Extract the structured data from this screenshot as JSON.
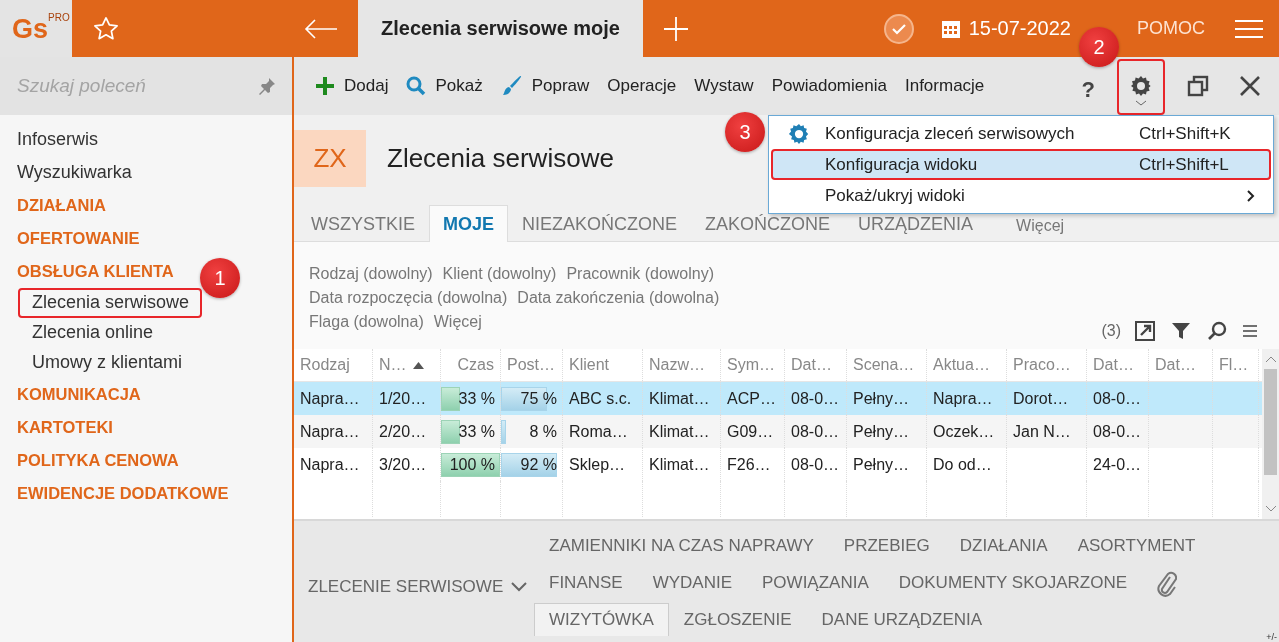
{
  "app": {
    "logo": "Gs",
    "logo_badge": "PRO"
  },
  "topbar": {
    "title": "Zlecenia serwisowe moje",
    "date": "15-07-2022",
    "help": "POMOC"
  },
  "sidebar": {
    "search": {
      "placeholder": "Szukaj poleceń"
    },
    "items": [
      {
        "label": "Infoserwis",
        "kind": "link"
      },
      {
        "label": "Wyszukiwarka",
        "kind": "link"
      },
      {
        "label": "DZIAŁANIA",
        "kind": "section"
      },
      {
        "label": "OFERTOWANIE",
        "kind": "section"
      },
      {
        "label": "OBSŁUGA KLIENTA",
        "kind": "section",
        "children": [
          {
            "label": "Zlecenia serwisowe",
            "highlighted": true,
            "annotation": "1"
          },
          {
            "label": "Zlecenia online",
            "highlighted": false
          },
          {
            "label": "Umowy z klientami",
            "highlighted": false
          }
        ]
      },
      {
        "label": "KOMUNIKACJA",
        "kind": "section"
      },
      {
        "label": "KARTOTEKI",
        "kind": "section"
      },
      {
        "label": "POLITYKA CENOWA",
        "kind": "section"
      },
      {
        "label": "EWIDENCJE DODATKOWE",
        "kind": "section"
      }
    ]
  },
  "toolbar": {
    "actions": [
      {
        "label": "Dodaj"
      },
      {
        "label": "Pokaż"
      },
      {
        "label": "Popraw"
      },
      {
        "label": "Operacje"
      },
      {
        "label": "Wystaw"
      },
      {
        "label": "Powiadomienia"
      },
      {
        "label": "Informacje"
      }
    ],
    "help": "?",
    "settings": {
      "highlighted": true,
      "annotation": "2"
    }
  },
  "menu": {
    "items": [
      {
        "label": "Konfiguracja zleceń serwisowych",
        "shortcut": "Ctrl+Shift+K",
        "selected": false,
        "highlighted": false,
        "annotation": "3"
      },
      {
        "label": "Konfiguracja widoku",
        "shortcut": "Ctrl+Shift+L",
        "selected": true,
        "highlighted": true
      },
      {
        "label": "Pokaż/ukryj widoki",
        "submenu": true,
        "selected": false,
        "highlighted": false
      }
    ]
  },
  "module": {
    "badge": "ZX",
    "title": "Zlecenia serwisowe"
  },
  "tabs": [
    {
      "label": "WSZYSTKIE",
      "selected": false
    },
    {
      "label": "MOJE",
      "selected": true
    },
    {
      "label": "NIEZAKOŃCZONE",
      "selected": false
    },
    {
      "label": "ZAKOŃCZONE",
      "selected": false
    },
    {
      "label": "URZĄDZENIA",
      "selected": false
    },
    {
      "label": "Więcej",
      "selected": false,
      "kind": "more"
    }
  ],
  "filters": [
    [
      "Rodzaj (dowolny)",
      "Klient (dowolny)",
      "Pracownik (dowolny)"
    ],
    [
      "Data rozpoczęcia (dowolna)",
      "Data zakończenia (dowolna)"
    ],
    [
      "Flaga (dowolna)",
      "Więcej"
    ]
  ],
  "count": "(3)",
  "table": {
    "columns": [
      {
        "label": "Rodzaj",
        "sorted": false
      },
      {
        "label": "N…",
        "sorted": true
      },
      {
        "label": "Czas",
        "sorted": false
      },
      {
        "label": "Post…",
        "sorted": false
      },
      {
        "label": "Klient",
        "sorted": false
      },
      {
        "label": "Nazw…",
        "sorted": false
      },
      {
        "label": "Sym…",
        "sorted": false
      },
      {
        "label": "Dat…",
        "sorted": false
      },
      {
        "label": "Scena…",
        "sorted": false
      },
      {
        "label": "Aktua…",
        "sorted": false
      },
      {
        "label": "Praco…",
        "sorted": false
      },
      {
        "label": "Dat…",
        "sorted": false
      },
      {
        "label": "Dat…",
        "sorted": false
      },
      {
        "label": "Fl…",
        "sorted": false
      }
    ],
    "rows": [
      {
        "selected": true,
        "cells": [
          "Napra…",
          "1/20…",
          {
            "text": "33 %",
            "level": 0.33
          },
          {
            "text": "75 %",
            "level": 0.75
          },
          "ABC s.c.",
          "Klimat…",
          "ACP…",
          "08-0…",
          "Pełny…",
          "Napra…",
          "Dorot…",
          "08-0…"
        ]
      },
      {
        "selected": false,
        "cells": [
          "Napra…",
          "2/20…",
          {
            "text": "33 %",
            "level": 0.33
          },
          {
            "text": "8 %",
            "level": 0.08
          },
          "Roma…",
          "Klimat…",
          "G09…",
          "08-0…",
          "Pełny…",
          "Oczek…",
          "Jan N…",
          "08-0…"
        ]
      },
      {
        "selected": false,
        "cells": [
          "Napra…",
          "3/20…",
          {
            "text": "100 %",
            "level": 1
          },
          {
            "text": "92 %",
            "level": 0.92
          },
          "Sklep…",
          "Klimat…",
          "F26…",
          "08-0…",
          "Pełny…",
          "Do od…",
          null,
          "24-0…"
        ]
      }
    ]
  },
  "details": {
    "section": "ZLECENIE SERWISOWE",
    "tab_rows": [
      [
        {
          "label": "ZAMIENNIKI NA CZAS NAPRAWY",
          "selected": false
        },
        {
          "label": "PRZEBIEG",
          "selected": false
        },
        {
          "label": "DZIAŁANIA",
          "selected": false
        },
        {
          "label": "ASORTYMENT",
          "selected": false
        }
      ],
      [
        {
          "label": "FINANSE",
          "selected": false
        },
        {
          "label": "WYDANIE",
          "selected": false
        },
        {
          "label": "POWIĄZANIA",
          "selected": false
        },
        {
          "label": "DOKUMENTY SKOJARZONE",
          "selected": false
        },
        {
          "kind": "attachments",
          "selected": false
        }
      ],
      [
        {
          "label": "WIZYTÓWKA",
          "selected": true
        },
        {
          "label": "ZGŁOSZENIE",
          "selected": false
        },
        {
          "label": "DANE URZĄDZENIA",
          "selected": false
        }
      ]
    ],
    "corner": "+/-"
  }
}
